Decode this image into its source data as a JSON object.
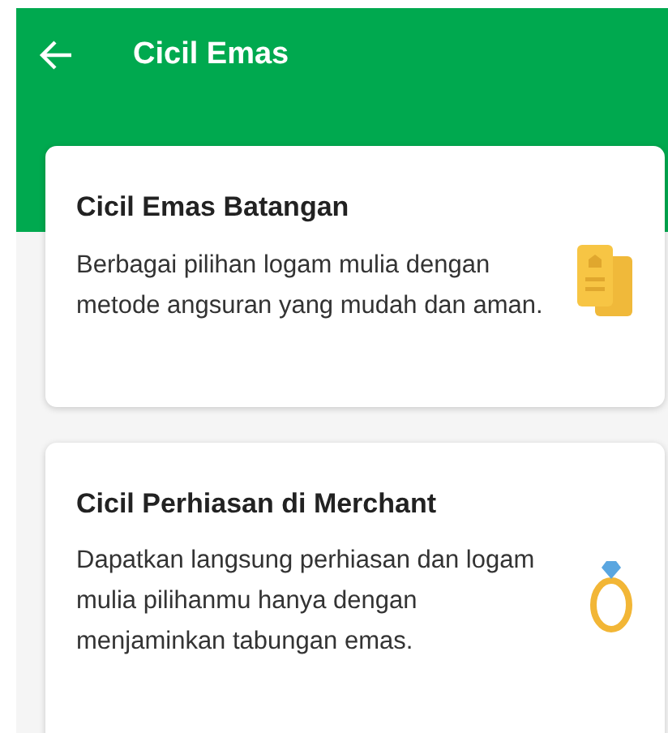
{
  "app_bar": {
    "title": "Cicil Emas"
  },
  "cards": [
    {
      "kind": "bars",
      "title": "Cicil Emas Batangan",
      "description": "Berbagai pilihan logam mulia dengan metode angsuran yang mudah dan aman."
    },
    {
      "kind": "ring",
      "title": "Cicil Perhiasan di Merchant",
      "description": "Dapatkan langsung perhiasan dan logam mulia pilihanmu hanya dengan menjaminkan tabungan emas."
    }
  ]
}
